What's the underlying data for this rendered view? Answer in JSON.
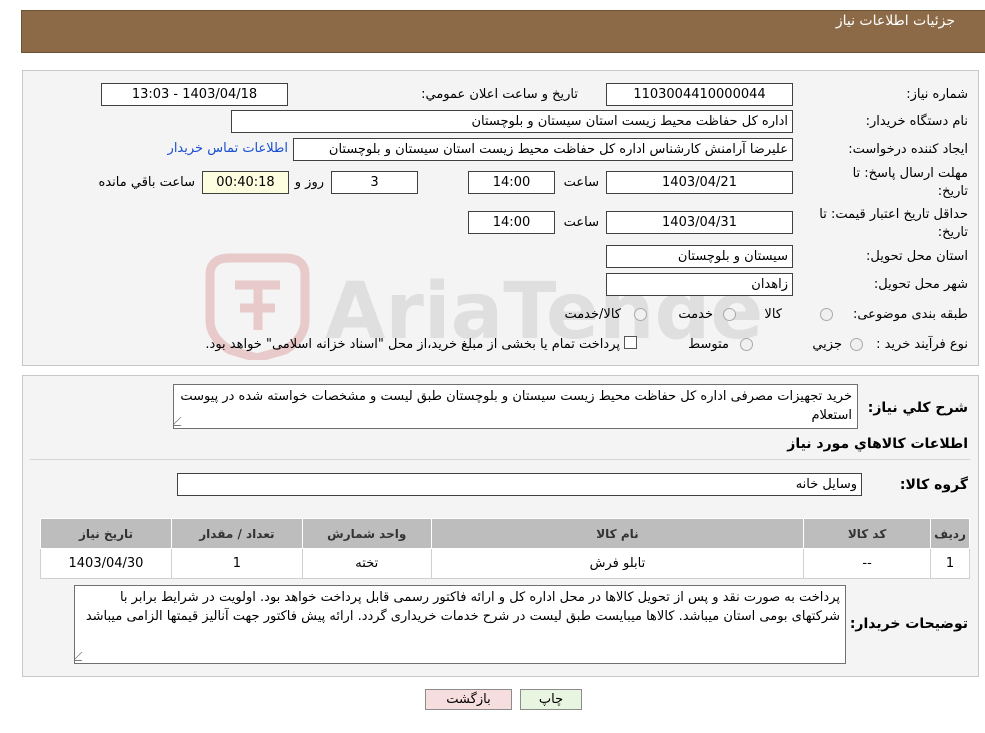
{
  "header": {
    "title": "جزئيات اطلاعات نياز"
  },
  "fields": {
    "need_number_label": "شماره نياز:",
    "need_number": "1103004410000044",
    "announce_label": "تاريخ و ساعت اعلان عمومي:",
    "announce_value": "1403/04/18 - 13:03",
    "buyer_org_label": "نام دستگاه خريدار:",
    "buyer_org": "اداره کل حفاظت محیط زیست استان سیستان و بلوچستان",
    "requester_label": "ايجاد کننده درخواست:",
    "requester": "علیرضا آرامنش کارشناس اداره کل حفاظت محیط زیست استان سیستان و بلوچستان",
    "contact_link": "اطلاعات تماس خريدار",
    "deadline_label_line1": "مهلت ارسال پاسخ: تا",
    "deadline_label_line2": "تاريخ:",
    "deadline_date": "1403/04/21",
    "time_label": "ساعت",
    "deadline_time": "14:00",
    "days_value": "3",
    "days_label": "روز و",
    "remaining_time": "00:40:18",
    "remaining_label": "ساعت باقي مانده",
    "validity_label_line1": "حداقل تاريخ اعتبار قيمت: تا",
    "validity_label_line2": "تاريخ:",
    "validity_date": "1403/04/31",
    "validity_time": "14:00",
    "province_label": "استان محل تحويل:",
    "province": "سیستان و بلوچستان",
    "city_label": "شهر محل تحويل:",
    "city": "زاهدان",
    "category_label": "طبقه بندی موضوعی:",
    "category_options": [
      "کالا",
      "خدمت",
      "کالا/خدمت"
    ],
    "process_label": "نوع فرآيند خريد :",
    "process_options": [
      "جزيي",
      "متوسط"
    ],
    "process_note": "پرداخت تمام يا بخشی از مبلغ خريد،از محل \"اسناد خزانه اسلامی\" خواهد بود."
  },
  "description": {
    "label": "شرح كلي نياز:",
    "text": "خرید تجهیزات مصرفی اداره کل حفاظت محیط زیست سیستان و بلوچستان طبق لیست و مشخصات خواسته شده در پیوست استعلام"
  },
  "goods": {
    "section_title": "اطلاعات کالاهاي مورد نياز",
    "group_label": "گروه کالا:",
    "group_value": "وسایل خانه",
    "columns": [
      "رديف",
      "کد کالا",
      "نام کالا",
      "واحد شمارش",
      "تعداد / مقدار",
      "تاريخ نياز"
    ],
    "rows": [
      [
        "1",
        "--",
        "تابلو فرش",
        "تخته",
        "1",
        "1403/04/30"
      ]
    ]
  },
  "buyer_notes": {
    "label": "توضيحات خريدار:",
    "text": "پرداخت به صورت نقد و پس از تحویل کالاها در محل اداره کل و ارائه فاکتور رسمی قابل پرداخت خواهد بود. اولویت در شرایط برابر با شرکتهای بومی استان میباشد. کالاها میبایست طبق لیست در شرح خدمات خریداری گردد. ارائه پیش فاکتور جهت آنالیز قیمتها الزامی میباشد"
  },
  "buttons": {
    "print": "چاپ",
    "back": "بازگشت"
  },
  "watermark": {
    "text": "AriaTender.neT"
  },
  "colors": {
    "header_bg": "#8c6a47",
    "link": "#1a4fd1",
    "back_bg": "#f7dede",
    "print_bg": "#e8f5e0"
  }
}
